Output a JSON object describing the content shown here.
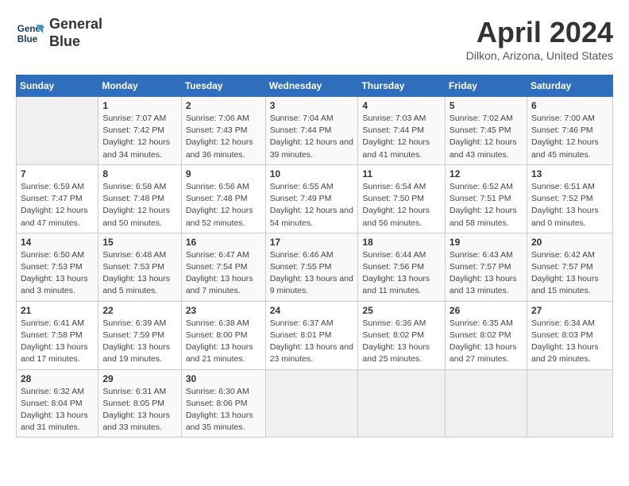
{
  "header": {
    "logo_line1": "General",
    "logo_line2": "Blue",
    "month_year": "April 2024",
    "location": "Dilkon, Arizona, United States"
  },
  "weekdays": [
    "Sunday",
    "Monday",
    "Tuesday",
    "Wednesday",
    "Thursday",
    "Friday",
    "Saturday"
  ],
  "weeks": [
    [
      {
        "day": "",
        "empty": true
      },
      {
        "day": "1",
        "sunrise": "Sunrise: 7:07 AM",
        "sunset": "Sunset: 7:42 PM",
        "daylight": "Daylight: 12 hours and 34 minutes."
      },
      {
        "day": "2",
        "sunrise": "Sunrise: 7:06 AM",
        "sunset": "Sunset: 7:43 PM",
        "daylight": "Daylight: 12 hours and 36 minutes."
      },
      {
        "day": "3",
        "sunrise": "Sunrise: 7:04 AM",
        "sunset": "Sunset: 7:44 PM",
        "daylight": "Daylight: 12 hours and 39 minutes."
      },
      {
        "day": "4",
        "sunrise": "Sunrise: 7:03 AM",
        "sunset": "Sunset: 7:44 PM",
        "daylight": "Daylight: 12 hours and 41 minutes."
      },
      {
        "day": "5",
        "sunrise": "Sunrise: 7:02 AM",
        "sunset": "Sunset: 7:45 PM",
        "daylight": "Daylight: 12 hours and 43 minutes."
      },
      {
        "day": "6",
        "sunrise": "Sunrise: 7:00 AM",
        "sunset": "Sunset: 7:46 PM",
        "daylight": "Daylight: 12 hours and 45 minutes."
      }
    ],
    [
      {
        "day": "7",
        "sunrise": "Sunrise: 6:59 AM",
        "sunset": "Sunset: 7:47 PM",
        "daylight": "Daylight: 12 hours and 47 minutes."
      },
      {
        "day": "8",
        "sunrise": "Sunrise: 6:58 AM",
        "sunset": "Sunset: 7:48 PM",
        "daylight": "Daylight: 12 hours and 50 minutes."
      },
      {
        "day": "9",
        "sunrise": "Sunrise: 6:56 AM",
        "sunset": "Sunset: 7:48 PM",
        "daylight": "Daylight: 12 hours and 52 minutes."
      },
      {
        "day": "10",
        "sunrise": "Sunrise: 6:55 AM",
        "sunset": "Sunset: 7:49 PM",
        "daylight": "Daylight: 12 hours and 54 minutes."
      },
      {
        "day": "11",
        "sunrise": "Sunrise: 6:54 AM",
        "sunset": "Sunset: 7:50 PM",
        "daylight": "Daylight: 12 hours and 56 minutes."
      },
      {
        "day": "12",
        "sunrise": "Sunrise: 6:52 AM",
        "sunset": "Sunset: 7:51 PM",
        "daylight": "Daylight: 12 hours and 58 minutes."
      },
      {
        "day": "13",
        "sunrise": "Sunrise: 6:51 AM",
        "sunset": "Sunset: 7:52 PM",
        "daylight": "Daylight: 13 hours and 0 minutes."
      }
    ],
    [
      {
        "day": "14",
        "sunrise": "Sunrise: 6:50 AM",
        "sunset": "Sunset: 7:53 PM",
        "daylight": "Daylight: 13 hours and 3 minutes."
      },
      {
        "day": "15",
        "sunrise": "Sunrise: 6:48 AM",
        "sunset": "Sunset: 7:53 PM",
        "daylight": "Daylight: 13 hours and 5 minutes."
      },
      {
        "day": "16",
        "sunrise": "Sunrise: 6:47 AM",
        "sunset": "Sunset: 7:54 PM",
        "daylight": "Daylight: 13 hours and 7 minutes."
      },
      {
        "day": "17",
        "sunrise": "Sunrise: 6:46 AM",
        "sunset": "Sunset: 7:55 PM",
        "daylight": "Daylight: 13 hours and 9 minutes."
      },
      {
        "day": "18",
        "sunrise": "Sunrise: 6:44 AM",
        "sunset": "Sunset: 7:56 PM",
        "daylight": "Daylight: 13 hours and 11 minutes."
      },
      {
        "day": "19",
        "sunrise": "Sunrise: 6:43 AM",
        "sunset": "Sunset: 7:57 PM",
        "daylight": "Daylight: 13 hours and 13 minutes."
      },
      {
        "day": "20",
        "sunrise": "Sunrise: 6:42 AM",
        "sunset": "Sunset: 7:57 PM",
        "daylight": "Daylight: 13 hours and 15 minutes."
      }
    ],
    [
      {
        "day": "21",
        "sunrise": "Sunrise: 6:41 AM",
        "sunset": "Sunset: 7:58 PM",
        "daylight": "Daylight: 13 hours and 17 minutes."
      },
      {
        "day": "22",
        "sunrise": "Sunrise: 6:39 AM",
        "sunset": "Sunset: 7:59 PM",
        "daylight": "Daylight: 13 hours and 19 minutes."
      },
      {
        "day": "23",
        "sunrise": "Sunrise: 6:38 AM",
        "sunset": "Sunset: 8:00 PM",
        "daylight": "Daylight: 13 hours and 21 minutes."
      },
      {
        "day": "24",
        "sunrise": "Sunrise: 6:37 AM",
        "sunset": "Sunset: 8:01 PM",
        "daylight": "Daylight: 13 hours and 23 minutes."
      },
      {
        "day": "25",
        "sunrise": "Sunrise: 6:36 AM",
        "sunset": "Sunset: 8:02 PM",
        "daylight": "Daylight: 13 hours and 25 minutes."
      },
      {
        "day": "26",
        "sunrise": "Sunrise: 6:35 AM",
        "sunset": "Sunset: 8:02 PM",
        "daylight": "Daylight: 13 hours and 27 minutes."
      },
      {
        "day": "27",
        "sunrise": "Sunrise: 6:34 AM",
        "sunset": "Sunset: 8:03 PM",
        "daylight": "Daylight: 13 hours and 29 minutes."
      }
    ],
    [
      {
        "day": "28",
        "sunrise": "Sunrise: 6:32 AM",
        "sunset": "Sunset: 8:04 PM",
        "daylight": "Daylight: 13 hours and 31 minutes."
      },
      {
        "day": "29",
        "sunrise": "Sunrise: 6:31 AM",
        "sunset": "Sunset: 8:05 PM",
        "daylight": "Daylight: 13 hours and 33 minutes."
      },
      {
        "day": "30",
        "sunrise": "Sunrise: 6:30 AM",
        "sunset": "Sunset: 8:06 PM",
        "daylight": "Daylight: 13 hours and 35 minutes."
      },
      {
        "day": "",
        "empty": true
      },
      {
        "day": "",
        "empty": true
      },
      {
        "day": "",
        "empty": true
      },
      {
        "day": "",
        "empty": true
      }
    ]
  ]
}
